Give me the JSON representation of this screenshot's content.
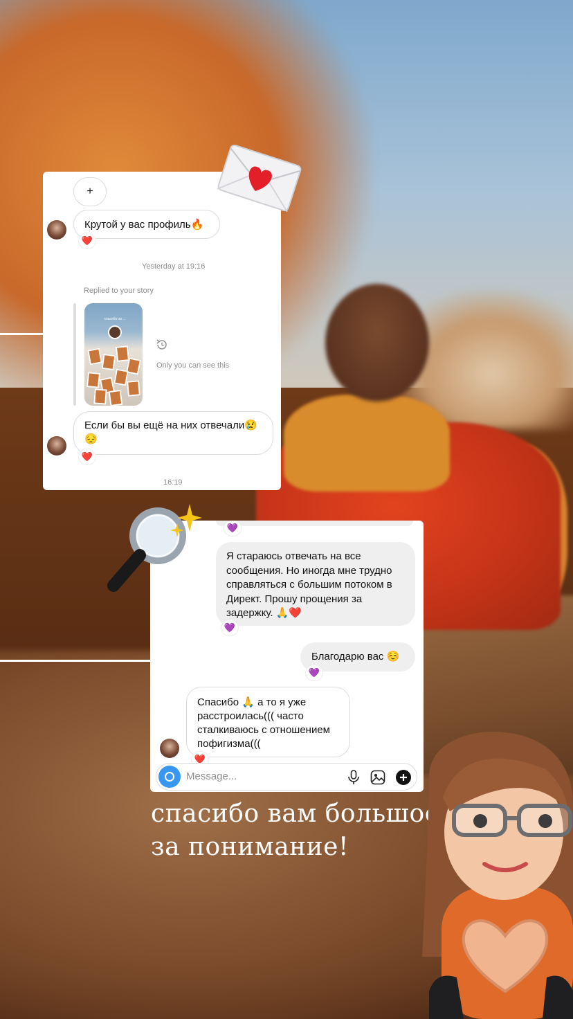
{
  "card1": {
    "plus_label": "+",
    "msg1_text": "Крутой у вас профиль🔥",
    "msg1_reaction": "❤️",
    "timestamp1": "Yesterday at 19:16",
    "story_label": "Replied to your story",
    "story_preview_text": "спасибо за ...",
    "visibility_text": "Only you can see this",
    "msg2_line1": "Если бы вы ещё на них отвечали😢",
    "msg2_line2": "😔",
    "msg2_reaction": "❤️",
    "timestamp2": "16:19"
  },
  "card2": {
    "top_reaction": "💜",
    "reply_lines": [
      "Я стараюсь отвечать на все",
      "сообщения. Но иногда мне трудно",
      "справляться с большим потоком в",
      "Директ. Прошу прощения за",
      "задержку. 🙏❤️"
    ],
    "reply_reaction": "💜",
    "thanks_text": "Благодарю вас ☺️",
    "thanks_reaction": "💜",
    "incoming_lines": [
      "Спасибо 🙏 а то я уже",
      "расстроилась((( часто",
      "сталкиваюсь с отношением",
      "пофигизма((("
    ],
    "incoming_reaction": "❤️",
    "message_placeholder": "Message..."
  },
  "headline": {
    "line1": "спасибо вам большое",
    "line2": "за понимание!"
  },
  "icons": {
    "envelope": "envelope-heart-icon",
    "magnifier": "magnifying-glass-icon",
    "sparkles": "sparkles-icon",
    "replay": "replay-icon",
    "mic": "microphone-icon",
    "gallery": "gallery-icon",
    "add": "add-circle-icon",
    "camera": "camera-icon"
  },
  "colors": {
    "instagram_blue": "#3897f0",
    "reaction_purple": "#8b3fd9",
    "reaction_red": "#e0242e"
  }
}
